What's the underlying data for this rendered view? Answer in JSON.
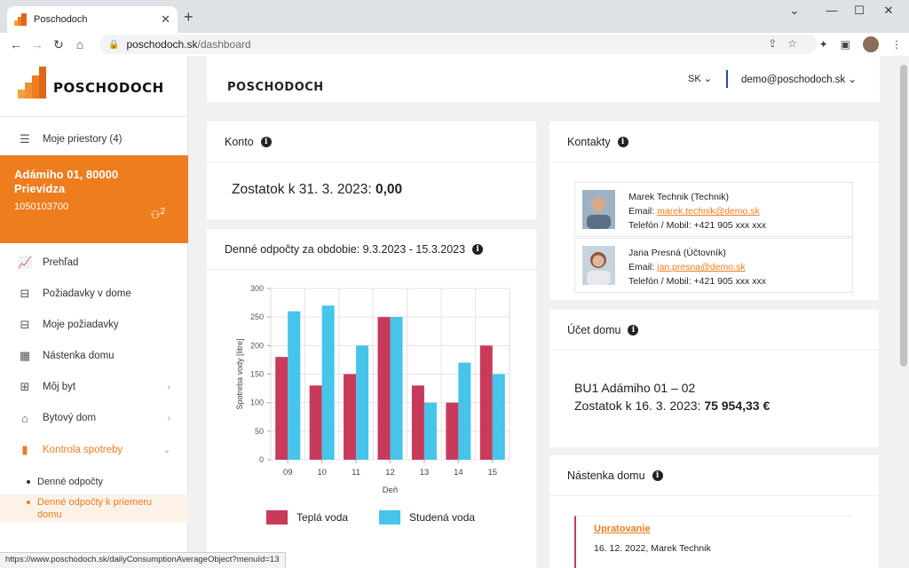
{
  "browser": {
    "tab_title": "Poschodoch",
    "url_host": "poschodoch.sk",
    "url_path": "/dashboard",
    "status_url": "https://www.poschodoch.sk/dailyConsumptionAverageObject?menuId=13"
  },
  "sidebar": {
    "logo_text": "POSCHODOCH",
    "premises_label": "Moje priestory (4)",
    "property": {
      "name_line1": "Adámiho 01, 80000",
      "name_line2": "Prievidza",
      "code": "1050103700",
      "people_count": "2"
    },
    "items": [
      {
        "label": "Prehľad",
        "icon": "chart-icon"
      },
      {
        "label": "Požiadavky v dome",
        "icon": "inbox-icon"
      },
      {
        "label": "Moje požiadavky",
        "icon": "inbox-icon"
      },
      {
        "label": "Nástenka domu",
        "icon": "calendar-icon"
      },
      {
        "label": "Môj byt",
        "icon": "floorplan-icon"
      },
      {
        "label": "Bytový dom",
        "icon": "house-icon"
      },
      {
        "label": "Kontrola spotreby",
        "icon": "bar-chart-icon"
      }
    ],
    "subitems": [
      {
        "label": "Denné odpočty"
      },
      {
        "label": "Denné odpočty k priemeru domu"
      }
    ]
  },
  "topbar": {
    "brand": "POSCHODOCH",
    "lang": "SK",
    "user": "demo@poschodoch.sk"
  },
  "konto": {
    "title": "Konto",
    "balance_label": "Zostatok k 31. 3. 2023:",
    "balance_value": "0,00"
  },
  "readings": {
    "title": "Denné odpočty za obdobie: 9.3.2023 - 15.3.2023"
  },
  "chart_data": {
    "type": "bar",
    "categories": [
      "09",
      "10",
      "11",
      "12",
      "13",
      "14",
      "15"
    ],
    "series": [
      {
        "name": "Teplá voda",
        "color": "#c83a5a",
        "values": [
          180,
          130,
          150,
          250,
          130,
          100,
          200
        ]
      },
      {
        "name": "Studená voda",
        "color": "#46c4ea",
        "values": [
          260,
          270,
          200,
          250,
          100,
          170,
          150
        ]
      }
    ],
    "xlabel": "Deň",
    "ylabel": "Spotreba vody [litre]",
    "ylim": [
      0,
      300
    ],
    "yticks": [
      0,
      50,
      100,
      150,
      200,
      250,
      300
    ],
    "grid": true,
    "legend": "bottom"
  },
  "contacts": {
    "title": "Kontakty",
    "people": [
      {
        "name": "Marek Technik (Technik)",
        "email_label": "Email:",
        "email": "marek.technik@demo.sk",
        "phone": "Telefón / Mobil: +421 905 xxx xxx"
      },
      {
        "name": "Jana Presná (Účtovník)",
        "email_label": "Email:",
        "email": "jan.presna@demo.sk",
        "phone": "Telefón / Mobil: +421 905 xxx xxx"
      }
    ]
  },
  "ucet": {
    "title": "Účet domu",
    "line1": "BU1 Adámiho 01 – 02",
    "balance_label": "Zostatok k 16. 3. 2023:",
    "balance_value": "75 954,33 €"
  },
  "nastenka": {
    "title": "Nástenka domu",
    "post_title": "Upratovanie",
    "post_meta": "16. 12. 2022, Marek Technik"
  },
  "colors": {
    "accent": "#ee7d1e",
    "hot": "#c83a5a",
    "cold": "#46c4ea"
  }
}
